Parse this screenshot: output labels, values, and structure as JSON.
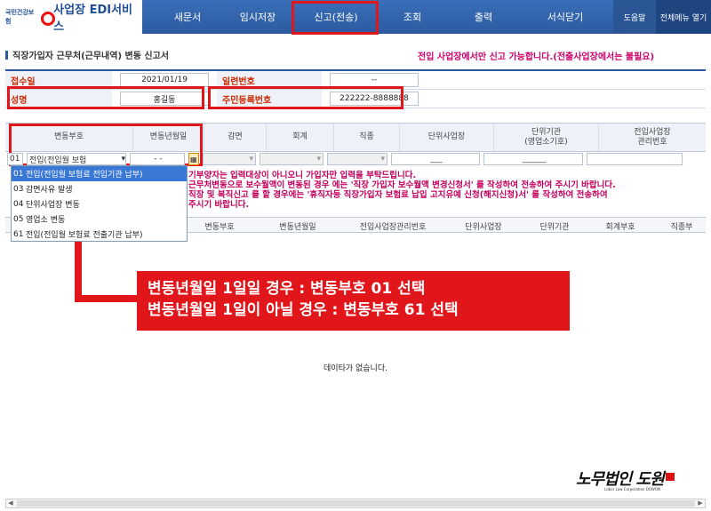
{
  "header": {
    "org_small": "국민건강보험",
    "app_title": "사업장 EDI서비스",
    "menus": [
      "새문서",
      "임시저장",
      "신고(전송)",
      "조회",
      "출력",
      "서식닫기"
    ],
    "help": "도움말",
    "all_menu": "전체메뉴 열기"
  },
  "page": {
    "title": "직장가입자 근무처(근무내역) 변동 신고서",
    "notice": "전입 사업장에서만 신고 가능합니다.(전출사업장에서는 불필요)"
  },
  "form": {
    "received_date_label": "접수일",
    "received_date": "2021/01/19",
    "serial_label": "일련번호",
    "serial": "--",
    "name_label": "성명",
    "name": "홍길동",
    "rrn_label": "주민등록번호",
    "rrn": "222222-8888888"
  },
  "grid": {
    "headers": [
      "변동부호",
      "변동년월일",
      "감면",
      "회계",
      "직종",
      "단위사업장",
      "단위기관\n(영업소기호)",
      "전입사업장\n관리번호"
    ],
    "row": {
      "code": "01",
      "code_value": "전입(전입월 보험",
      "date": "- -",
      "unit": "___",
      "agency": "______"
    }
  },
  "dropdown": {
    "options": [
      {
        "code": "01",
        "label": "전입(전입월 보험료 전입기관 납부)"
      },
      {
        "code": "03",
        "label": "감면사유 발생"
      },
      {
        "code": "04",
        "label": "단위사업장 변동"
      },
      {
        "code": "05",
        "label": "영업소 변동"
      },
      {
        "code": "61",
        "label": "전입(전입월 보험료 전출기관 납부)"
      }
    ]
  },
  "warning": [
    "기부양자는 입력대상이 아니오니 가입자만 입력을 부탁드립니다.",
    "근무처변동으로 보수월액이 변동된 경우 에는 '직장 가입자 보수월액 변경신청서' 를 작성하여 전송하여 주시기 바랍니다.",
    "직장 및 복직신고 를 할 경우에는 '휴직자등 직장가입자 보험료 납입 고지유예 신청(해지신청)서' 를 작성하여 전송하여",
    "주시기 바랍니다."
  ],
  "list_headers": [
    "변동부호",
    "변동년월일",
    "전입사업장관리번호",
    "단위사업장",
    "단위기관",
    "회계부호",
    "직종부"
  ],
  "callout": {
    "line1": "변동년월일 1일일 경우 : 변동부호 01 선택",
    "line2": "변동년월일 1일이 아닐 경우 : 변동부호 61 선택"
  },
  "no_data": "데이타가 없습니다.",
  "watermark": "노무법인 도원",
  "watermark_sub": "Labor Law Corporation DOWON",
  "colors": {
    "primary": "#2c5aa0",
    "highlight": "#e0161b",
    "warn": "#c4005d"
  }
}
